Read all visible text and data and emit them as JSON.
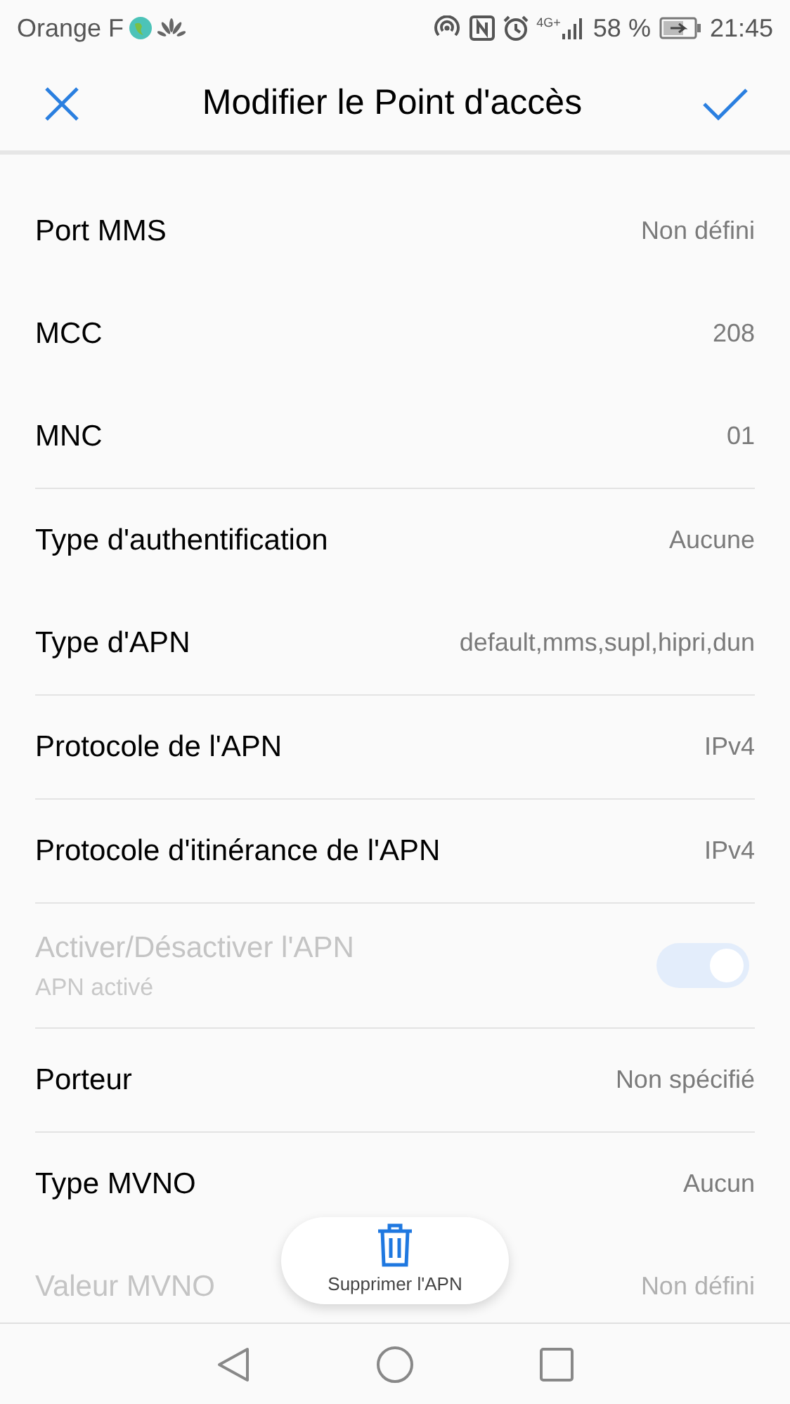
{
  "status_bar": {
    "carrier": "Orange F",
    "battery": "58 %",
    "time": "21:45",
    "network": "4G+"
  },
  "header": {
    "title": "Modifier le Point d'accès"
  },
  "sections": [
    {
      "rows": [
        {
          "kind": "value",
          "label": "Port MMS",
          "value": "Non défini",
          "disabled": false
        },
        {
          "kind": "value",
          "label": "MCC",
          "value": "208",
          "disabled": false
        },
        {
          "kind": "value",
          "label": "MNC",
          "value": "01",
          "disabled": false
        }
      ]
    },
    {
      "rows": [
        {
          "kind": "value",
          "label": "Type d'authentification",
          "value": "Aucune",
          "disabled": false
        },
        {
          "kind": "value",
          "label": "Type d'APN",
          "value": "default,mms,supl,hipri,dun",
          "disabled": false
        }
      ]
    },
    {
      "rows": [
        {
          "kind": "value",
          "label": "Protocole de l'APN",
          "value": "IPv4",
          "disabled": false
        }
      ]
    },
    {
      "rows": [
        {
          "kind": "value",
          "label": "Protocole d'itinérance de l'APN",
          "value": "IPv4",
          "disabled": false
        }
      ]
    },
    {
      "rows": [
        {
          "kind": "toggle",
          "label": "Activer/Désactiver l'APN",
          "sublabel": "APN activé",
          "on": true,
          "disabled": true
        }
      ]
    },
    {
      "rows": [
        {
          "kind": "value",
          "label": "Porteur",
          "value": "Non spécifié",
          "disabled": false
        }
      ]
    },
    {
      "rows": [
        {
          "kind": "value",
          "label": "Type MVNO",
          "value": "Aucun",
          "disabled": false
        },
        {
          "kind": "value",
          "label": "Valeur MVNO",
          "value": "Non défini",
          "disabled": true
        }
      ]
    }
  ],
  "delete_button": {
    "label": "Supprimer l'APN"
  }
}
